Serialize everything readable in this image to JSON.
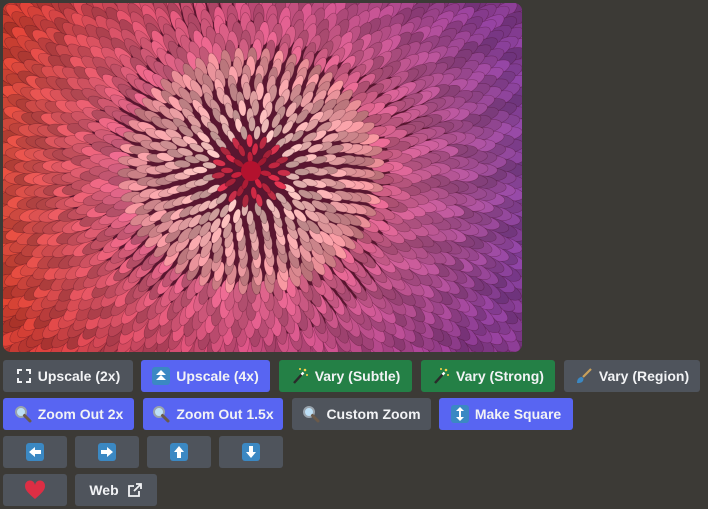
{
  "image": {
    "alt": ""
  },
  "rows": [
    [
      {
        "id": "upscale-2x",
        "label": "Upscale (2x)",
        "icon": "expand-corners-icon",
        "variant": "gray"
      },
      {
        "id": "upscale-4x",
        "label": "Upscale (4x)",
        "icon": "double-up-arrow-icon",
        "variant": "blue"
      },
      {
        "id": "vary-subtle",
        "label": "Vary (Subtle)",
        "icon": "magic-wand-icon",
        "variant": "green"
      },
      {
        "id": "vary-strong",
        "label": "Vary (Strong)",
        "icon": "magic-wand-icon",
        "variant": "green"
      },
      {
        "id": "vary-region",
        "label": "Vary (Region)",
        "icon": "paintbrush-icon",
        "variant": "gray"
      }
    ],
    [
      {
        "id": "zoom-out-2x",
        "label": "Zoom Out 2x",
        "icon": "magnifier-icon",
        "variant": "blue"
      },
      {
        "id": "zoom-out-1-5x",
        "label": "Zoom Out 1.5x",
        "icon": "magnifier-icon",
        "variant": "blue"
      },
      {
        "id": "custom-zoom",
        "label": "Custom Zoom",
        "icon": "magnifier-icon",
        "variant": "gray"
      },
      {
        "id": "make-square",
        "label": "Make Square",
        "icon": "up-down-arrow-icon",
        "variant": "blue"
      }
    ],
    [
      {
        "id": "pan-left",
        "label": "",
        "icon": "left-arrow-icon",
        "variant": "gray"
      },
      {
        "id": "pan-right",
        "label": "",
        "icon": "right-arrow-icon",
        "variant": "gray"
      },
      {
        "id": "pan-up",
        "label": "",
        "icon": "up-arrow-icon",
        "variant": "gray"
      },
      {
        "id": "pan-down",
        "label": "",
        "icon": "down-arrow-icon",
        "variant": "gray"
      }
    ],
    [
      {
        "id": "favorite",
        "label": "",
        "icon": "heart-icon",
        "variant": "gray"
      },
      {
        "id": "web",
        "label": "Web",
        "icon": "",
        "variant": "gray",
        "trail_icon": "external-link-icon"
      }
    ]
  ],
  "colors": {
    "blue": "#5865f2",
    "green": "#248046",
    "gray": "#4f545c",
    "arrow": "#3b88c3",
    "heart": "#dd2e44"
  }
}
